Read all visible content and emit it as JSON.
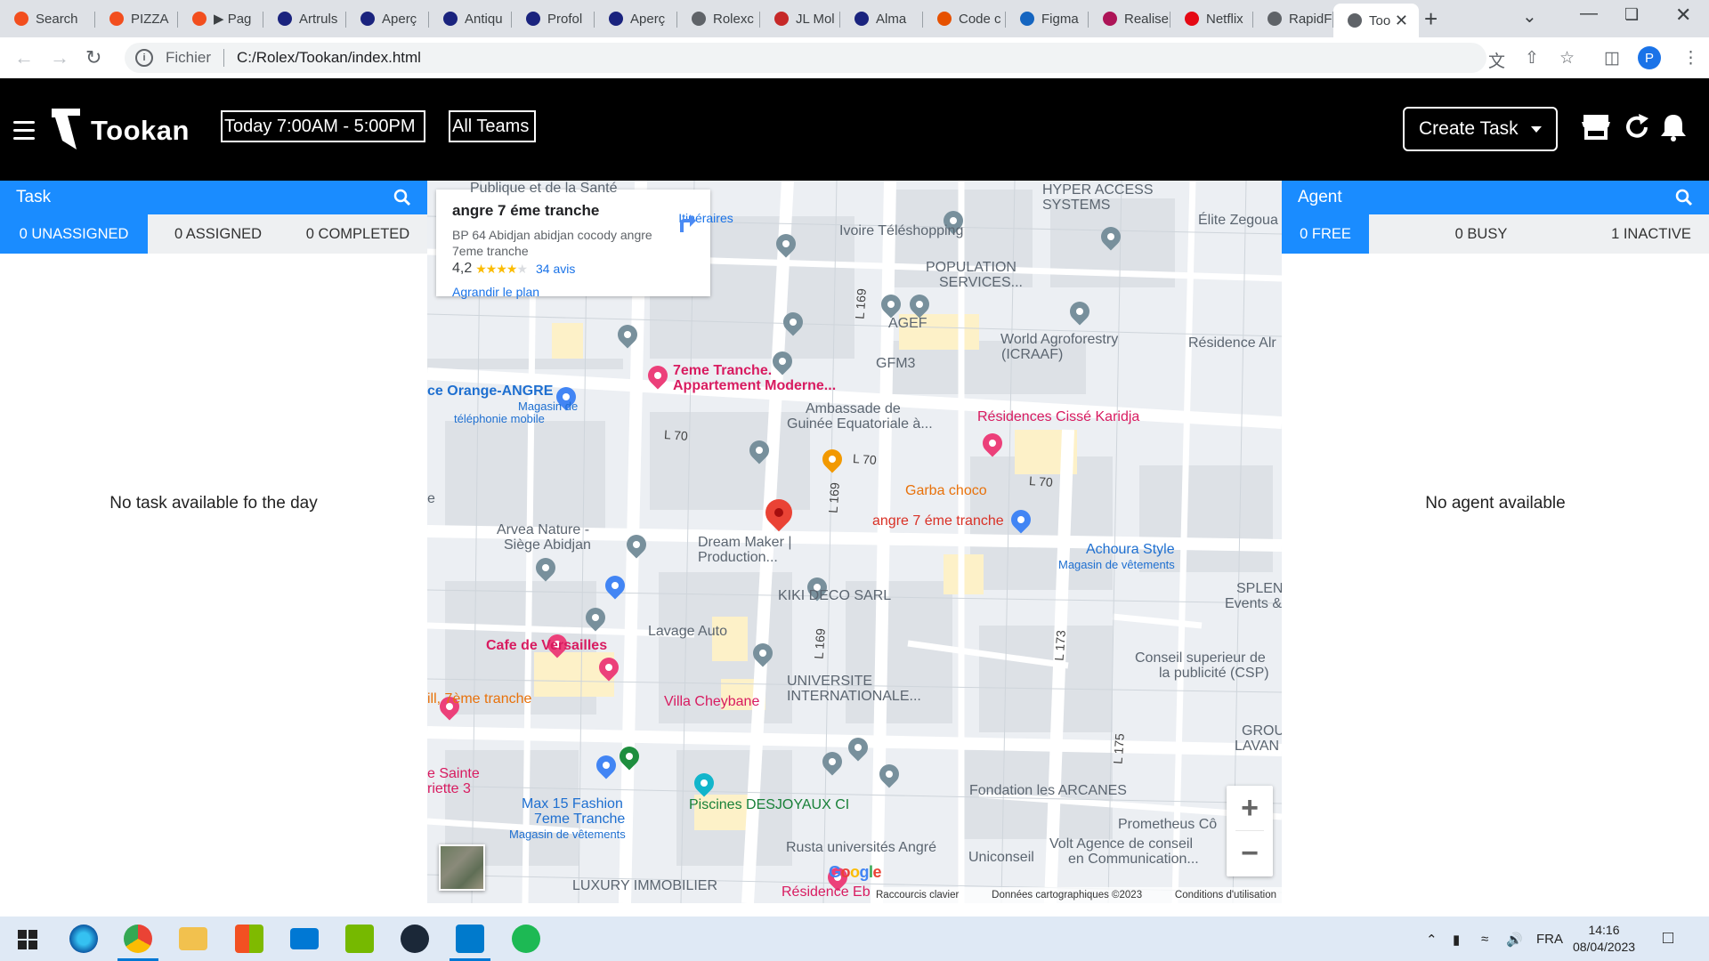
{
  "browser": {
    "tabs": [
      {
        "label": "Search",
        "icon": "figma-icon",
        "color": "#f24e1e"
      },
      {
        "label": "PIZZA",
        "icon": "figma-icon",
        "color": "#f24e1e"
      },
      {
        "label": "▶ Pag",
        "icon": "figma-icon",
        "color": "#f24e1e"
      },
      {
        "label": "Artruls",
        "icon": "globe-icon",
        "color": "#1a237e"
      },
      {
        "label": "Aperç",
        "icon": "globe-icon",
        "color": "#1a237e"
      },
      {
        "label": "Antiqu",
        "icon": "globe-icon",
        "color": "#1a237e"
      },
      {
        "label": "Profol",
        "icon": "globe-icon",
        "color": "#1a237e"
      },
      {
        "label": "Aperç",
        "icon": "globe-icon",
        "color": "#1a237e"
      },
      {
        "label": "Rolexc",
        "icon": "globe-icon",
        "color": "#5f6368"
      },
      {
        "label": "JL Mol",
        "icon": "jl-icon",
        "color": "#c62828"
      },
      {
        "label": "Alma",
        "icon": "globe-icon",
        "color": "#1a237e"
      },
      {
        "label": "Code c",
        "icon": "code-icon",
        "color": "#e65100"
      },
      {
        "label": "Figma",
        "icon": "flag-icon",
        "color": "#1565c0"
      },
      {
        "label": "Realise",
        "icon": "realise-icon",
        "color": "#ad1457"
      },
      {
        "label": "Netflix",
        "icon": "netflix-icon",
        "color": "#e50914"
      },
      {
        "label": "RapidF",
        "icon": "globe-icon",
        "color": "#5f6368"
      },
      {
        "label": "Too",
        "icon": "globe-icon",
        "color": "#5f6368",
        "active": true
      }
    ],
    "scheme_label": "Fichier",
    "url": "C:/Rolex/Tookan/index.html",
    "profile_initial": "P"
  },
  "header": {
    "brand": "Tookan",
    "date_range": "Today 7:00AM - 5:00PM",
    "teams_filter": "All Teams",
    "create_task_label": "Create Task"
  },
  "task_panel": {
    "title": "Task",
    "tabs": [
      "0 UNASSIGNED",
      "0 ASSIGNED",
      "0 COMPLETED"
    ],
    "empty_message": "No task available fo the day"
  },
  "agent_panel": {
    "title": "Agent",
    "tabs": [
      "0 FREE",
      "0 BUSY",
      "1 INACTIVE"
    ],
    "empty_message": "No agent available"
  },
  "map": {
    "info_card": {
      "title": "angre 7 éme tranche",
      "address": "BP 64 Abidjan abidjan cocody angre 7eme tranche",
      "rating": "4,2",
      "stars": "★★★★",
      "stars_empty": "★",
      "reviews": "34 avis",
      "directions": "Itinéraires",
      "enlarge": "Agrandir le plan"
    },
    "labels": {
      "top_cut": "Publique et de la Santé",
      "hyper_access": "HYPER ACCESS",
      "hyper_systems": "SYSTEMS",
      "elite": "Élite Zegoua",
      "ivoire": "Ivoire Téléshopping",
      "population": "POPULATION",
      "services": "SERVICES...",
      "agef": "AGEF",
      "gfm3": "GFM3",
      "world_agro": "World Agroforestry",
      "icraaf": "(ICRAAF)",
      "residence_alr": "Résidence Alr",
      "appt_7e": "7eme Tranche.",
      "appt_moderne": "Appartement Moderne...",
      "orange_angre": "ce Orange-ANGRE",
      "orange_sub1": "Magasin de",
      "orange_sub2": "téléphonie mobile",
      "ambassade1": "Ambassade de",
      "ambassade2": "Guinée Equatoriale à...",
      "residences_cisse": "Résidences Cissé Karidja",
      "garba": "Garba choco",
      "angre_main": "angre 7 éme tranche",
      "arvea1": "Arvea Nature -",
      "arvea2": "Siège Abidjan",
      "dream1": "Dream Maker |",
      "dream2": "Production...",
      "achoura": "Achoura Style",
      "achoura_sub": "Magasin de vêtements",
      "splen1": "SPLEN",
      "splen2": "Events &",
      "kiki": "KIKI DECO SARL",
      "lavage": "Lavage Auto",
      "versailles": "Cafe de Versailles",
      "univ1": "UNIVERSITE",
      "univ2": "INTERNATIONALE...",
      "conseil1": "Conseil superieur de",
      "conseil2": "la publicité (CSP)",
      "hill": "ill, 7ème tranche",
      "cheybane": "Villa Cheybane",
      "grou1": "GROU",
      "grou2": "LAVAN",
      "sainte1": "e Sainte",
      "sainte2": "riette 3",
      "fondation": "Fondation les ARCANES",
      "max15_1": "Max 15 Fashion",
      "max15_2": "7eme Tranche",
      "max15_sub": "Magasin de vêtements",
      "piscines": "Piscines DESJOYAUX CI",
      "prometheus": "Prometheus Cô",
      "rusta": "Rusta universités Angré",
      "volt1": "Volt Agence de conseil",
      "volt2": "en Communication...",
      "uniconseil": "Uniconseil",
      "luxury": "LUXURY IMMOBILIER",
      "residence_eb": "Résidence Eb",
      "e_cut": "e"
    },
    "roads": {
      "l70_a": "L 70",
      "l70_b": "L 70",
      "l70_c": "L 70",
      "l169_a": "L 169",
      "l169_b": "L 169",
      "l169_c": "L 169",
      "l173": "L 173",
      "l175": "L 175"
    },
    "attribution": {
      "google": "Google",
      "shortcuts": "Raccourcis clavier",
      "data": "Données cartographiques ©2023",
      "terms": "Conditions d'utilisation"
    }
  },
  "taskbar": {
    "language": "FRA",
    "time": "14:16",
    "date": "08/04/2023"
  }
}
